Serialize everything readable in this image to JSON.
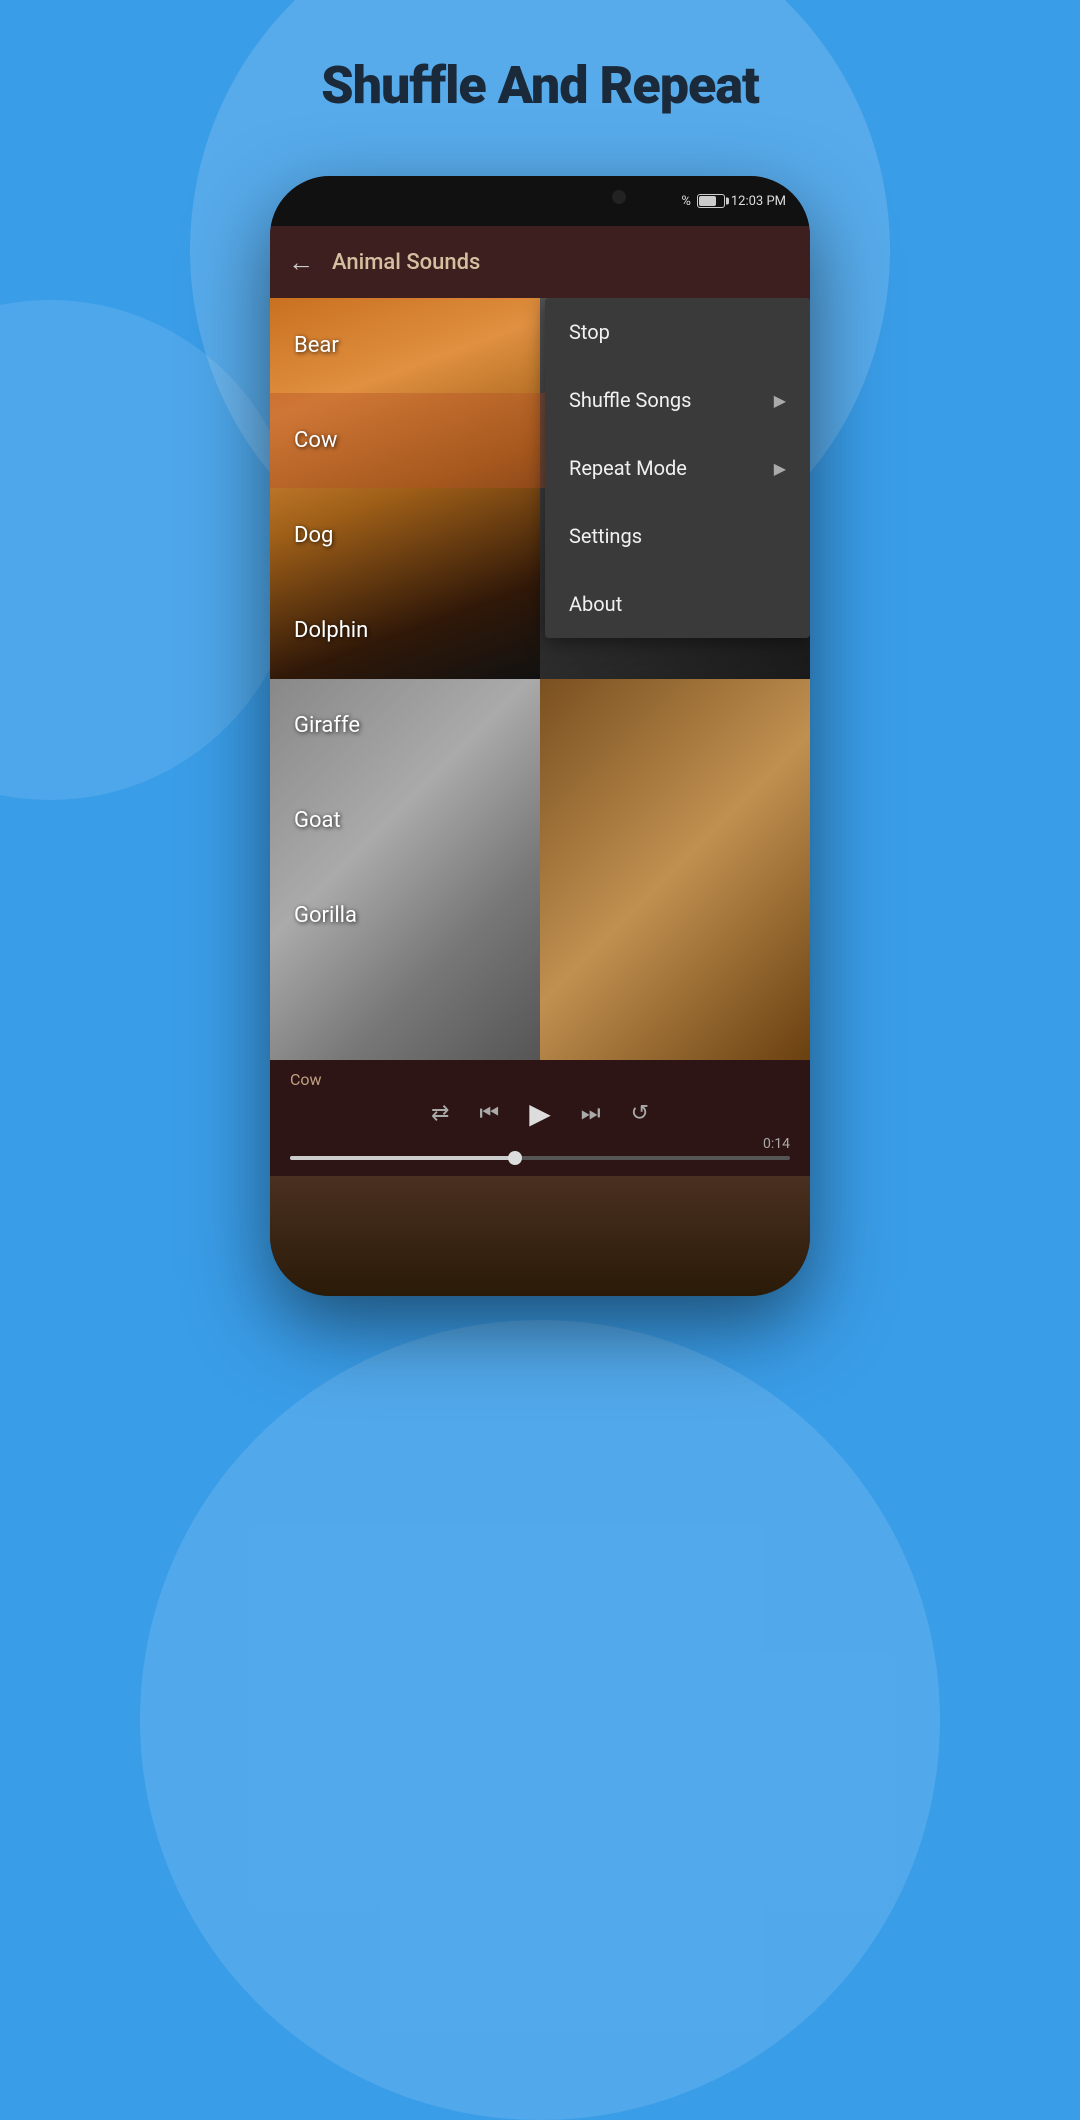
{
  "page": {
    "title": "Shuffle And Repeat",
    "background_color": "#3a9de8"
  },
  "phone": {
    "status_bar": {
      "battery_percent": "%",
      "time": "12:03 PM"
    }
  },
  "app": {
    "header_title": "Animal Sounds",
    "back_label": "←"
  },
  "animals": [
    {
      "name": "Bear",
      "active": false
    },
    {
      "name": "Cow",
      "active": true
    },
    {
      "name": "Dog",
      "active": false
    },
    {
      "name": "Dolphin",
      "active": false
    },
    {
      "name": "Giraffe",
      "active": false
    },
    {
      "name": "Goat",
      "active": false
    },
    {
      "name": "Gorilla",
      "active": false
    }
  ],
  "dropdown": {
    "items": [
      {
        "label": "Stop",
        "has_arrow": false
      },
      {
        "label": "Shuffle Songs",
        "has_arrow": true
      },
      {
        "label": "Repeat Mode",
        "has_arrow": true
      },
      {
        "label": "Settings",
        "has_arrow": false
      },
      {
        "label": "About",
        "has_arrow": false
      }
    ]
  },
  "player": {
    "current_track": "Cow",
    "time": "0:14",
    "progress_percent": 45
  },
  "controls": {
    "shuffle": "⇄",
    "prev": "⏮",
    "play": "▶",
    "next": "⏭",
    "repeat": "↺"
  }
}
